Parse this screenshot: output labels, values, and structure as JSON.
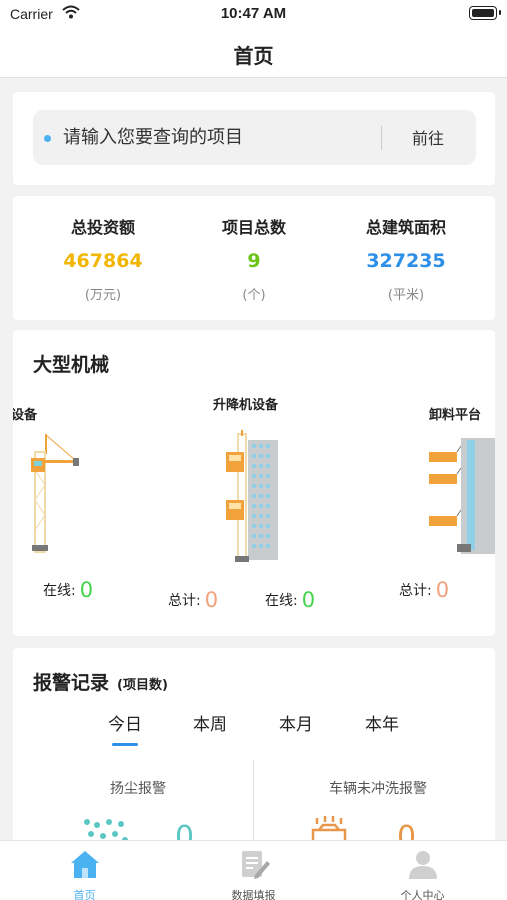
{
  "status_bar": {
    "carrier": "Carrier",
    "time": "10:47 AM"
  },
  "nav": {
    "title": "首页"
  },
  "search": {
    "placeholder": "请输入您要查询的项目",
    "go_label": "前往"
  },
  "stats": [
    {
      "label": "总投资额",
      "value": "467864",
      "unit": "(万元)",
      "color": "#f2b600"
    },
    {
      "label": "项目总数",
      "value": "9",
      "unit": "(个)",
      "color": "#6cc417"
    },
    {
      "label": "总建筑面积",
      "value": "327235",
      "unit": "(平米)",
      "color": "#2e8fe8"
    }
  ],
  "machinery": {
    "title": "大型机械",
    "left_name_partial": "设备",
    "left_online_label": "在线:",
    "left_online_value": "0",
    "center_name": "升降机设备",
    "center_total_label": "总计:",
    "center_total_value": "0",
    "center_online_label": "在线:",
    "center_online_value": "0",
    "right_name_partial": "卸料平台",
    "right_total_label": "总计:",
    "right_total_value": "0"
  },
  "alarm": {
    "title": "报警记录",
    "subtitle": "(项目数)",
    "tabs": [
      "今日",
      "本周",
      "本月",
      "本年"
    ],
    "active_tab": 0,
    "columns": [
      {
        "label": "扬尘报警",
        "value": "0"
      },
      {
        "label": "车辆未冲洗报警",
        "value": "0"
      }
    ]
  },
  "tab_bar": {
    "items": [
      {
        "label": "首页",
        "icon": "home-icon",
        "active": true
      },
      {
        "label": "数据填报",
        "icon": "edit-document-icon",
        "active": false
      },
      {
        "label": "个人中心",
        "icon": "user-icon",
        "active": false
      }
    ]
  },
  "colors": {
    "accent": "#4ab2f0",
    "online_green": "#44d44a",
    "total_orange": "#f2a27a"
  }
}
